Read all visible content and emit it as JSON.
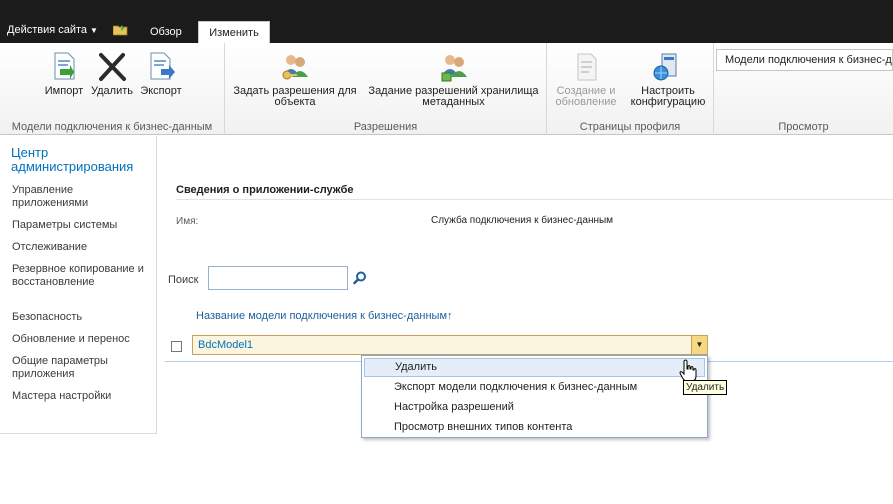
{
  "header": {
    "site_actions": "Действия сайта",
    "tabs": [
      {
        "label": "Обзор"
      },
      {
        "label": "Изменить"
      }
    ]
  },
  "ribbon": {
    "groups": [
      {
        "label": "Модели подключения к бизнес-данным",
        "buttons": [
          {
            "label": "Импорт",
            "icon": "import-icon"
          },
          {
            "label": "Удалить",
            "icon": "delete-icon"
          },
          {
            "label": "Экспорт",
            "icon": "export-icon"
          }
        ]
      },
      {
        "label": "Разрешения",
        "buttons": [
          {
            "label_line1": "Задать разрешения для",
            "label_line2": "объекта",
            "icon": "object-permissions-icon"
          },
          {
            "label_line1": "Задание разрешений хранилища",
            "label_line2": "метаданных",
            "icon": "metadata-permissions-icon"
          }
        ]
      },
      {
        "label": "Страницы профиля",
        "buttons": [
          {
            "label_line1": "Создание и",
            "label_line2": "обновление",
            "icon": "profile-page-icon",
            "disabled": true
          },
          {
            "label_line1": "Настроить",
            "label_line2": "конфигурацию",
            "icon": "configure-icon"
          }
        ]
      },
      {
        "label": "Просмотр",
        "view_select": "Модели подключения к бизнес-данным"
      }
    ]
  },
  "leftnav": {
    "title": "Центр администрирования",
    "items": [
      {
        "label": "Управление приложениями"
      },
      {
        "label": "Параметры системы"
      },
      {
        "label": "Отслеживание"
      },
      {
        "label": "Резервное копирование и восстановление"
      },
      {
        "label": "Безопасность"
      },
      {
        "label": "Обновление и перенос"
      },
      {
        "label": "Общие параметры приложения"
      },
      {
        "label": "Мастера настройки"
      }
    ]
  },
  "main": {
    "section_title": "Сведения о приложении-службе",
    "name_label": "Имя:",
    "name_value": "Служба подключения к бизнес-данным",
    "search_label": "Поиск",
    "search_value": "",
    "column_header": "Название модели подключения к бизнес-данным↑",
    "rows": [
      {
        "name": "BdcModel1"
      }
    ]
  },
  "context_menu": {
    "items": [
      {
        "label": "Удалить"
      },
      {
        "label": "Экспорт модели подключения к бизнес-данным"
      },
      {
        "label": "Настройка разрешений"
      },
      {
        "label": "Просмотр внешних типов контента"
      }
    ]
  },
  "tooltip": "Удалить"
}
